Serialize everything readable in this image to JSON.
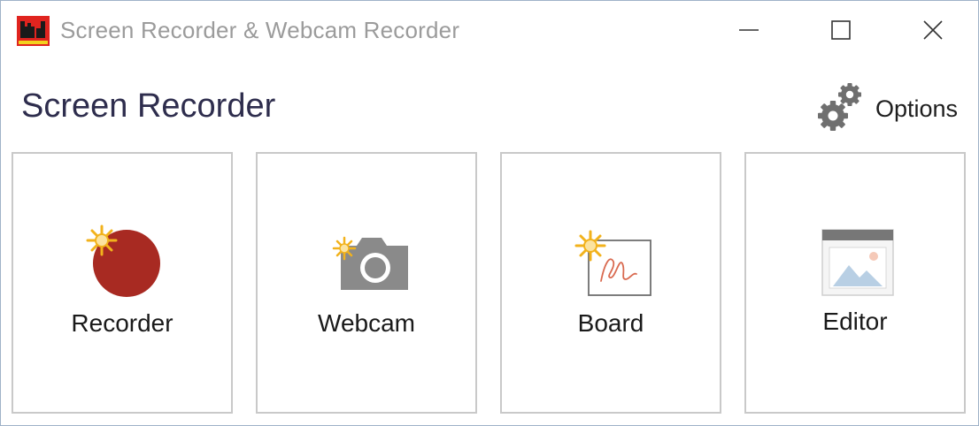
{
  "titlebar": {
    "title": "Screen Recorder & Webcam Recorder",
    "icons": {
      "app": "app-logo-icon",
      "minimize": "minimize-icon",
      "maximize": "maximize-icon",
      "close": "close-icon"
    }
  },
  "main": {
    "heading": "Screen Recorder",
    "options": {
      "label": "Options",
      "icon": "gears-icon"
    },
    "tiles": [
      {
        "label": "Recorder",
        "icon": "record-icon"
      },
      {
        "label": "Webcam",
        "icon": "camera-icon"
      },
      {
        "label": "Board",
        "icon": "whiteboard-icon"
      },
      {
        "label": "Editor",
        "icon": "image-editor-icon"
      }
    ]
  },
  "colors": {
    "app_icon_red": "#e0241f",
    "record_red": "#a82a22",
    "spark_yellow": "#f2b21c",
    "camera_gray": "#8a8a8a",
    "scribble_red": "#d96a50",
    "editor_bar": "#777777",
    "editor_sky": "#b8cfe4",
    "title_text": "#9b9b9b",
    "heading_text": "#2e2d4d"
  }
}
